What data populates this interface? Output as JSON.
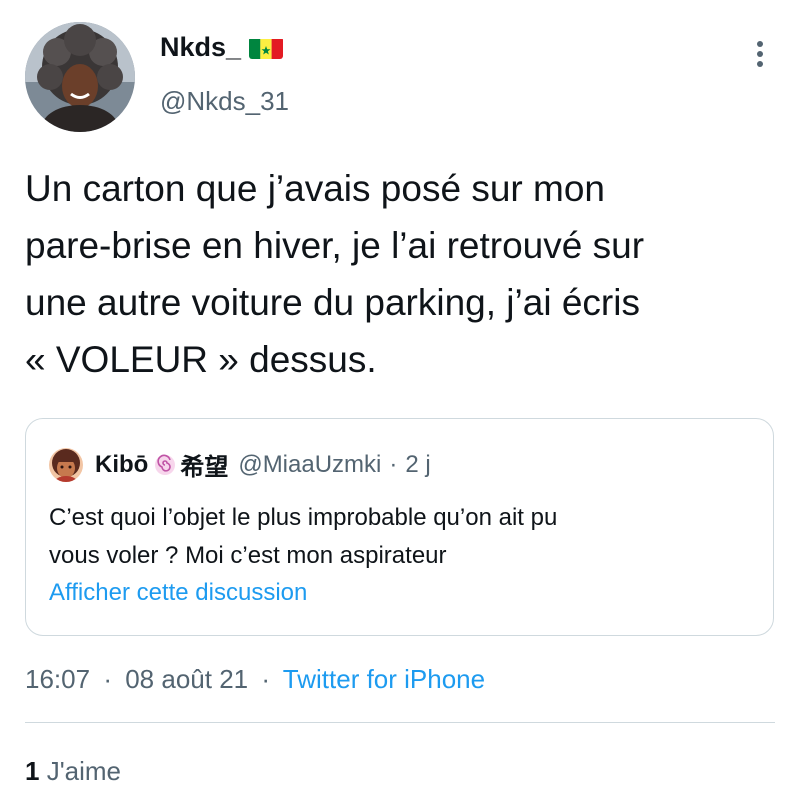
{
  "author": {
    "display_name": "Nkds_",
    "flag_icon": "senegal-flag-icon",
    "handle": "@Nkds_31"
  },
  "tweet": {
    "lines": [
      "Un carton que j’avais posé sur mon",
      "pare-brise en hiver, je l’ai retrouvé sur",
      "une autre voiture du parking, j’ai écris",
      "« VOLEUR » dessus."
    ]
  },
  "quoted_tweet": {
    "display_name": "Kibō",
    "name_suffix": "希望",
    "handle": "@MiaaUzmki",
    "separator": "·",
    "time_ago": "2 j",
    "lines": [
      "C’est quoi l’objet le plus improbable qu’on ait pu",
      "vous voler ? Moi c’est mon aspirateur"
    ],
    "show_thread_label": "Afficher cette discussion"
  },
  "meta": {
    "time": "16:07",
    "date": "08 août 21",
    "separator": "·",
    "source": "Twitter for iPhone"
  },
  "stats": {
    "likes_count": "1",
    "likes_label": "J'aime"
  },
  "colors": {
    "text_primary": "#0f1419",
    "text_secondary": "#536471",
    "link": "#1d9bf0",
    "border": "#cfd9de"
  }
}
